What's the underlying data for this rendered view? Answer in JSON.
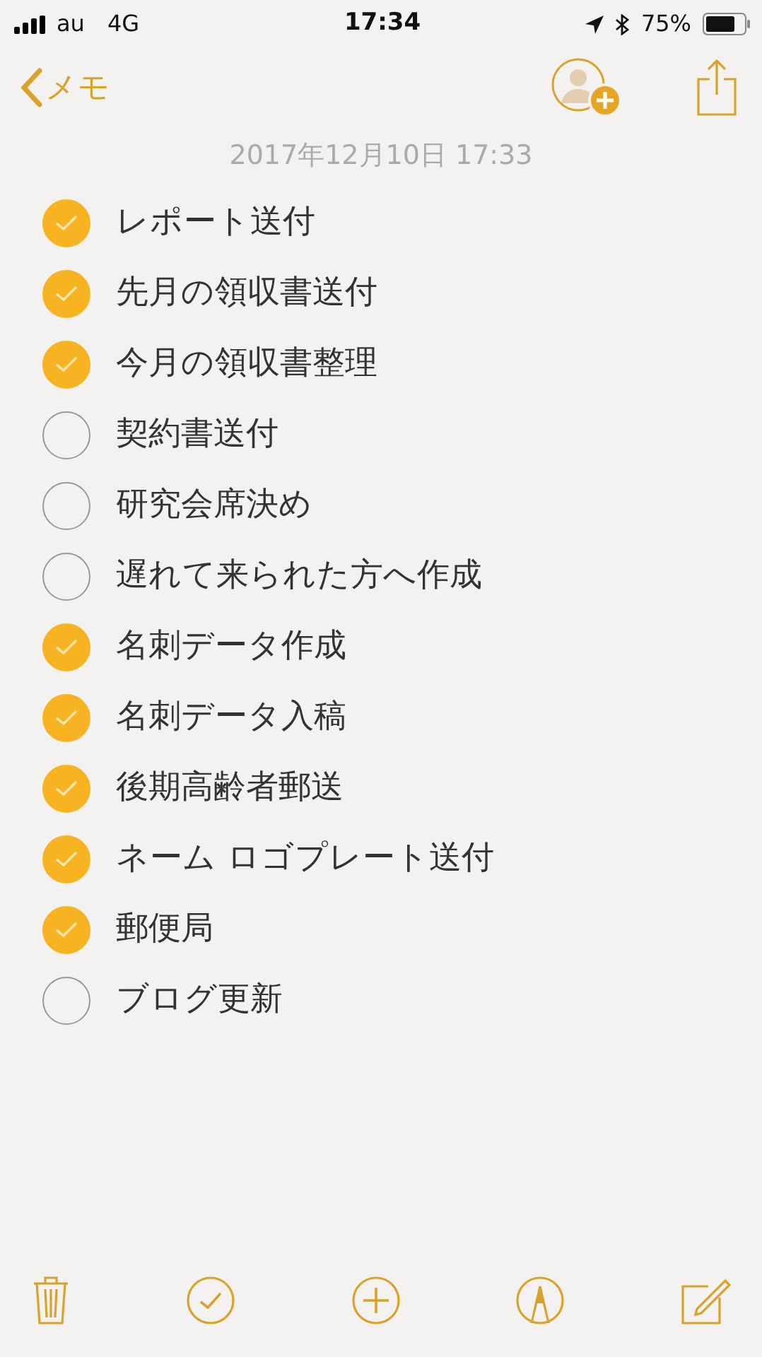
{
  "status_bar": {
    "carrier": "au",
    "network": "4G",
    "time": "17:34",
    "battery": "75%"
  },
  "nav": {
    "back": "メモ"
  },
  "note": {
    "date": "2017年12月10日 17:33",
    "items": [
      {
        "text": "レポート送付",
        "checked": true
      },
      {
        "text": "先月の領収書送付",
        "checked": true
      },
      {
        "text": "今月の領収書整理",
        "checked": true
      },
      {
        "text": "契約書送付",
        "checked": false
      },
      {
        "text": "研究会席決め",
        "checked": false
      },
      {
        "text": "遅れて来られた方へ作成",
        "checked": false
      },
      {
        "text": "名刺データ作成",
        "checked": true
      },
      {
        "text": "名刺データ入稿",
        "checked": true
      },
      {
        "text": "後期高齢者郵送",
        "checked": true
      },
      {
        "text": "ネーム ロゴプレート送付",
        "checked": true
      },
      {
        "text": "郵便局",
        "checked": true
      },
      {
        "text": "ブログ更新",
        "checked": false
      }
    ]
  }
}
